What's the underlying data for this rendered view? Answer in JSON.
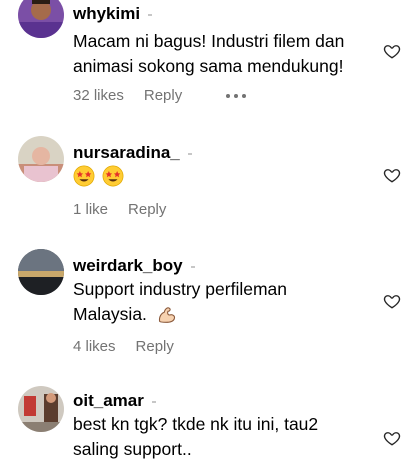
{
  "comments": [
    {
      "username": "whykimi",
      "text": "Macam ni bagus! Industri filem dan animasi sokong sama mendukung!",
      "line1": "Macam ni bagus! Industri filem dan",
      "line2": "animasi sokong sama mendukung!",
      "likes": "32 likes",
      "reply": "Reply",
      "avatar": "avatar-whykimi"
    },
    {
      "username": "nursaradina_",
      "text": "",
      "emojis": [
        "star-struck-emoji",
        "star-struck-emoji"
      ],
      "likes": "1 like",
      "reply": "Reply",
      "avatar": "avatar-nursaradina"
    },
    {
      "username": "weirdark_boy",
      "line1": "Support industry perfileman",
      "line2": "Malaysia.",
      "emojis": [
        "flexed-biceps-emoji"
      ],
      "likes": "4 likes",
      "reply": "Reply",
      "avatar": "avatar-weirdark"
    },
    {
      "username": "oit_amar",
      "line1": "best kn tgk? tkde nk itu ini, tau2",
      "line2": "saling support..",
      "avatar": "avatar-oit-amar"
    }
  ],
  "icons": {
    "heart": "heart-outline-icon",
    "more": "more-horizontal-icon"
  },
  "colors": {
    "meta": "#737373",
    "text": "#000000",
    "background": "#ffffff"
  }
}
